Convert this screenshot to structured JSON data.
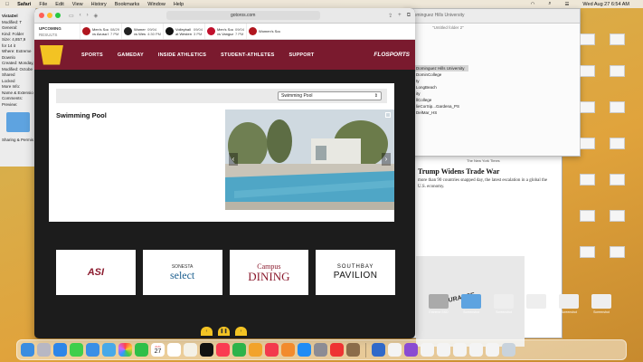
{
  "menubar": {
    "app": "Safari",
    "items": [
      "File",
      "Edit",
      "View",
      "History",
      "Bookmarks",
      "Window",
      "Help"
    ],
    "clock": "Wed Aug 27  6:54 AM"
  },
  "info_window": {
    "title": "VistaDel",
    "modified": "Modified: T",
    "lines": [
      "General:",
      "Kind: Folder",
      "Size: 4,857,9",
      "for 14 it",
      "Where: Extreme",
      "Downlo",
      "Created: Monday,",
      "Modified: Octobe",
      "Shared",
      "Locked",
      "More Info:",
      "Name & Extension:",
      "Comments:",
      "Preview:",
      "Sharing & Permiss"
    ]
  },
  "notes_window": {
    "title": "Dominguez Hills University",
    "subtitle": "\"Untitled folder 2\"",
    "items": [
      "Dominguez Hills University",
      "DominCollege",
      "ty",
      "LongBeach",
      "ity",
      "llCollege",
      "lieCorSip...Gardena_PS",
      "DelMar_HS"
    ],
    "selected_index": 0
  },
  "background_article": {
    "source": "The New York Times",
    "headline": "Trump Widens Trade War",
    "body": "more than 90 countries snapped day, the latest escalation in a global the U.S. economy.",
    "insurance_label": "INSURANCE"
  },
  "safari": {
    "url": "gotoros.com",
    "toolbar_icons": [
      "sidebar-icon",
      "back-icon",
      "forward-icon",
      "shield-icon",
      "share-icon",
      "new-tab-icon",
      "tabs-icon"
    ]
  },
  "results_strip": {
    "label": "UPCOMING",
    "sublabel": "RESULTS",
    "games": [
      {
        "sport": "Men's Soccer",
        "opponent": "vs Azusa Pacific Unive...",
        "date": "08/29",
        "time": "7 PM",
        "logo_color": "#b0151e"
      },
      {
        "sport": "Women's Soccer",
        "opponent": "vs Westmont College...",
        "date": "09/04",
        "time": "4:30 PM",
        "logo_color": "#222222"
      },
      {
        "sport": "Volleyball",
        "opponent": "at Western Oregon ...",
        "date": "09/04",
        "time": "3 PM",
        "logo_color": "#111111"
      },
      {
        "sport": "Men's Soccer",
        "opponent": "vs Vanguard Univer...",
        "date": "09/04",
        "time": "7 PM",
        "logo_color": "#c0102c"
      },
      {
        "sport": "Women's Soccer",
        "opponent": "",
        "date": "",
        "time": "",
        "logo_color": "#b0151e"
      }
    ]
  },
  "nav": {
    "items": [
      "SPORTS",
      "GAMEDAY",
      "INSIDE ATHLETICS",
      "STUDENT-ATHLETES",
      "SUPPORT"
    ],
    "partner": "FLOSPORTS",
    "brand_color": "#7a1a2e",
    "accent_color": "#f3c323"
  },
  "facility": {
    "selected": "Swimming Pool",
    "title": "Swimming Pool"
  },
  "sponsors": [
    {
      "name": "ASI"
    },
    {
      "name": "SONESTA",
      "sub": "select"
    },
    {
      "name": "Campus",
      "sub": "DINING"
    },
    {
      "name": "SOUTHBAY",
      "sub": "PAVILION"
    }
  ],
  "pager": {
    "prev": "‹",
    "pause": "❚❚",
    "next": "›"
  },
  "desktop": {
    "icons": [
      "Extreme SSD",
      "Screenshot",
      "Screenshot",
      "Screenshot",
      "Screenshot",
      "Screenshot"
    ]
  },
  "dock": {
    "calendar_month": "AUG",
    "calendar_day": "27"
  }
}
